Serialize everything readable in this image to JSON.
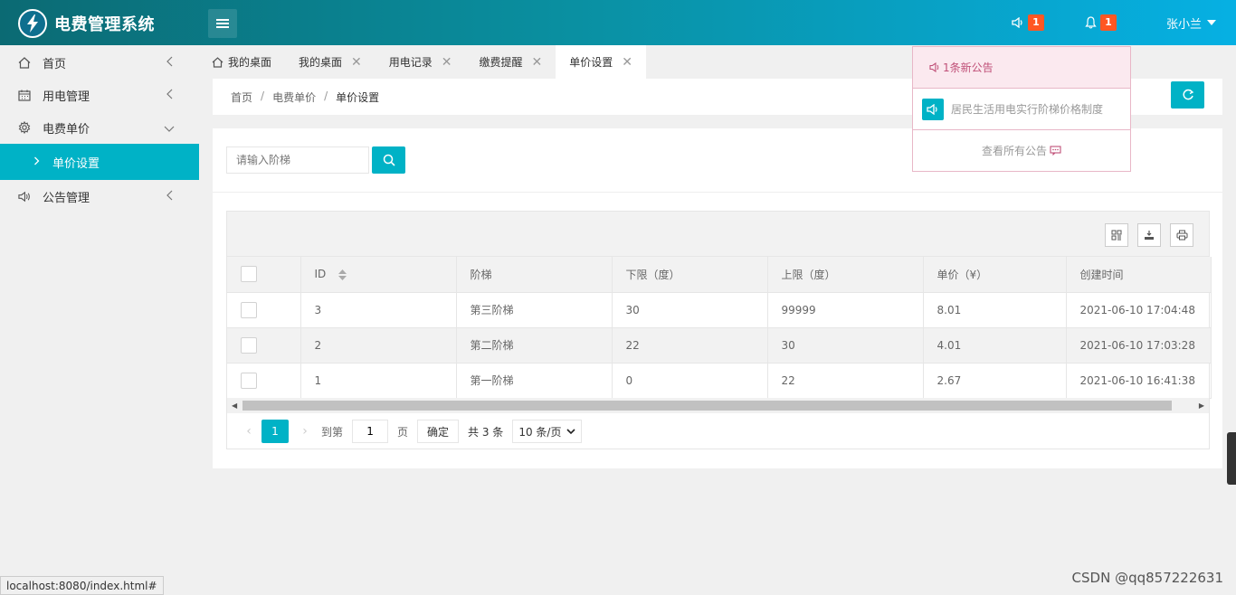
{
  "app": {
    "title": "电费管理系统"
  },
  "header": {
    "notice_badge": "1",
    "bell_badge": "1",
    "user_name": "张小兰"
  },
  "sidebar": {
    "items": [
      {
        "label": "首页",
        "icon": "home-icon"
      },
      {
        "label": "用电管理",
        "icon": "calendar-icon"
      },
      {
        "label": "电费单价",
        "icon": "gear-icon",
        "expanded": true
      },
      {
        "label": "公告管理",
        "icon": "speaker-icon"
      }
    ],
    "active_sub": {
      "label": "单价设置"
    }
  },
  "tabs": [
    {
      "label": "我的桌面",
      "closable": false,
      "home": true
    },
    {
      "label": "我的桌面",
      "closable": true
    },
    {
      "label": "用电记录",
      "closable": true
    },
    {
      "label": "缴费提醒",
      "closable": true
    },
    {
      "label": "单价设置",
      "closable": true,
      "active": true
    }
  ],
  "breadcrumb": [
    "首页",
    "电费单价",
    "单价设置"
  ],
  "search": {
    "placeholder": "请输入阶梯"
  },
  "table": {
    "columns": [
      "ID",
      "阶梯",
      "下限（度）",
      "上限（度）",
      "单价（¥）",
      "创建时间"
    ],
    "rows": [
      {
        "id": "3",
        "tier": "第三阶梯",
        "lower": "30",
        "upper": "99999",
        "price": "8.01",
        "created": "2021-06-10 17:04:48"
      },
      {
        "id": "2",
        "tier": "第二阶梯",
        "lower": "22",
        "upper": "30",
        "price": "4.01",
        "created": "2021-06-10 17:03:28"
      },
      {
        "id": "1",
        "tier": "第一阶梯",
        "lower": "0",
        "upper": "22",
        "price": "2.67",
        "created": "2021-06-10 16:41:38"
      }
    ]
  },
  "pager": {
    "current": "1",
    "goto_label": "到第",
    "goto_value": "1",
    "page_unit": "页",
    "ok_label": "确定",
    "total_label": "共 3 条",
    "page_size": "10 条/页"
  },
  "notice_dropdown": {
    "header": "1条新公告",
    "item": "居民生活用电实行阶梯价格制度",
    "footer": "查看所有公告"
  },
  "status_url": "localhost:8080/index.html#",
  "watermark": "CSDN @qq857222631",
  "colors": {
    "accent": "#00b2c6",
    "badge": "#ff5722",
    "header_start": "#0b6a73",
    "header_end": "#06b0e3"
  }
}
